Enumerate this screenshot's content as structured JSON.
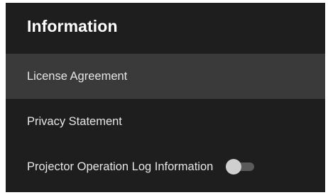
{
  "header": {
    "title": "Information"
  },
  "menu": {
    "items": [
      {
        "label": "License Agreement",
        "selected": true
      },
      {
        "label": "Privacy Statement",
        "selected": false
      },
      {
        "label": "Projector Operation Log Information",
        "selected": false,
        "toggle": {
          "on": false
        }
      }
    ]
  },
  "colors": {
    "background": "#1e1e1e",
    "selected_row": "#3a3a3a",
    "text": "#e6e6e6",
    "title": "#ffffff",
    "toggle_track": "#5a5a5a",
    "toggle_thumb": "#cfcfcf"
  }
}
